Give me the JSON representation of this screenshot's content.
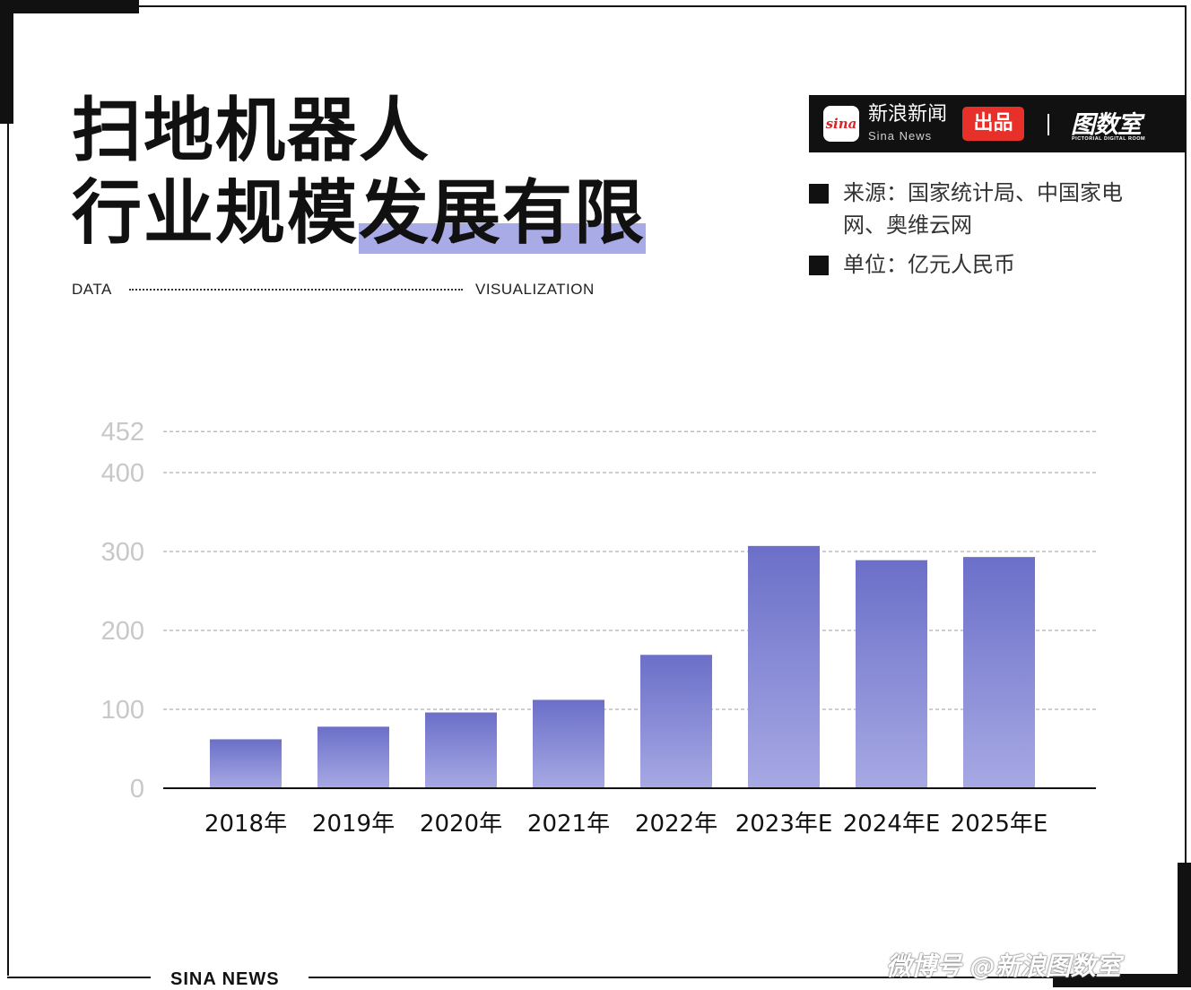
{
  "title": {
    "line1": "扫地机器人",
    "line2_plain": "行业规模",
    "line2_highlight": "发展有限"
  },
  "tagline": {
    "left": "DATA",
    "right": "VISUALIZATION"
  },
  "brand": {
    "logo_text": "sina",
    "name_cn": "新浪新闻",
    "name_en": "Sina News",
    "tag": "出品",
    "room_cn": "图数室",
    "room_en": "PICTORIAL DIGITAL ROOM"
  },
  "meta": {
    "source": "来源：国家统计局、中国家电网、奥维云网",
    "unit": "单位：亿元人民币"
  },
  "footer": {
    "label": "SINA NEWS",
    "watermark": "微博号 @新浪图数室"
  },
  "colors": {
    "bar_top": "#6b6fc8",
    "bar_bottom": "#a7a9e4",
    "highlight": "#a9abe6",
    "brand_red": "#e8302a"
  },
  "chart_data": {
    "type": "bar",
    "categories": [
      "2018年",
      "2019年",
      "2020年",
      "2021年",
      "2022年",
      "2023年E",
      "2024年E",
      "2025年E"
    ],
    "values": [
      62,
      78,
      96,
      112,
      169,
      307,
      289,
      293
    ],
    "yticks": [
      0,
      100,
      200,
      300,
      400,
      452
    ],
    "ylim": [
      0,
      452
    ],
    "grid": true,
    "legend": "none"
  }
}
